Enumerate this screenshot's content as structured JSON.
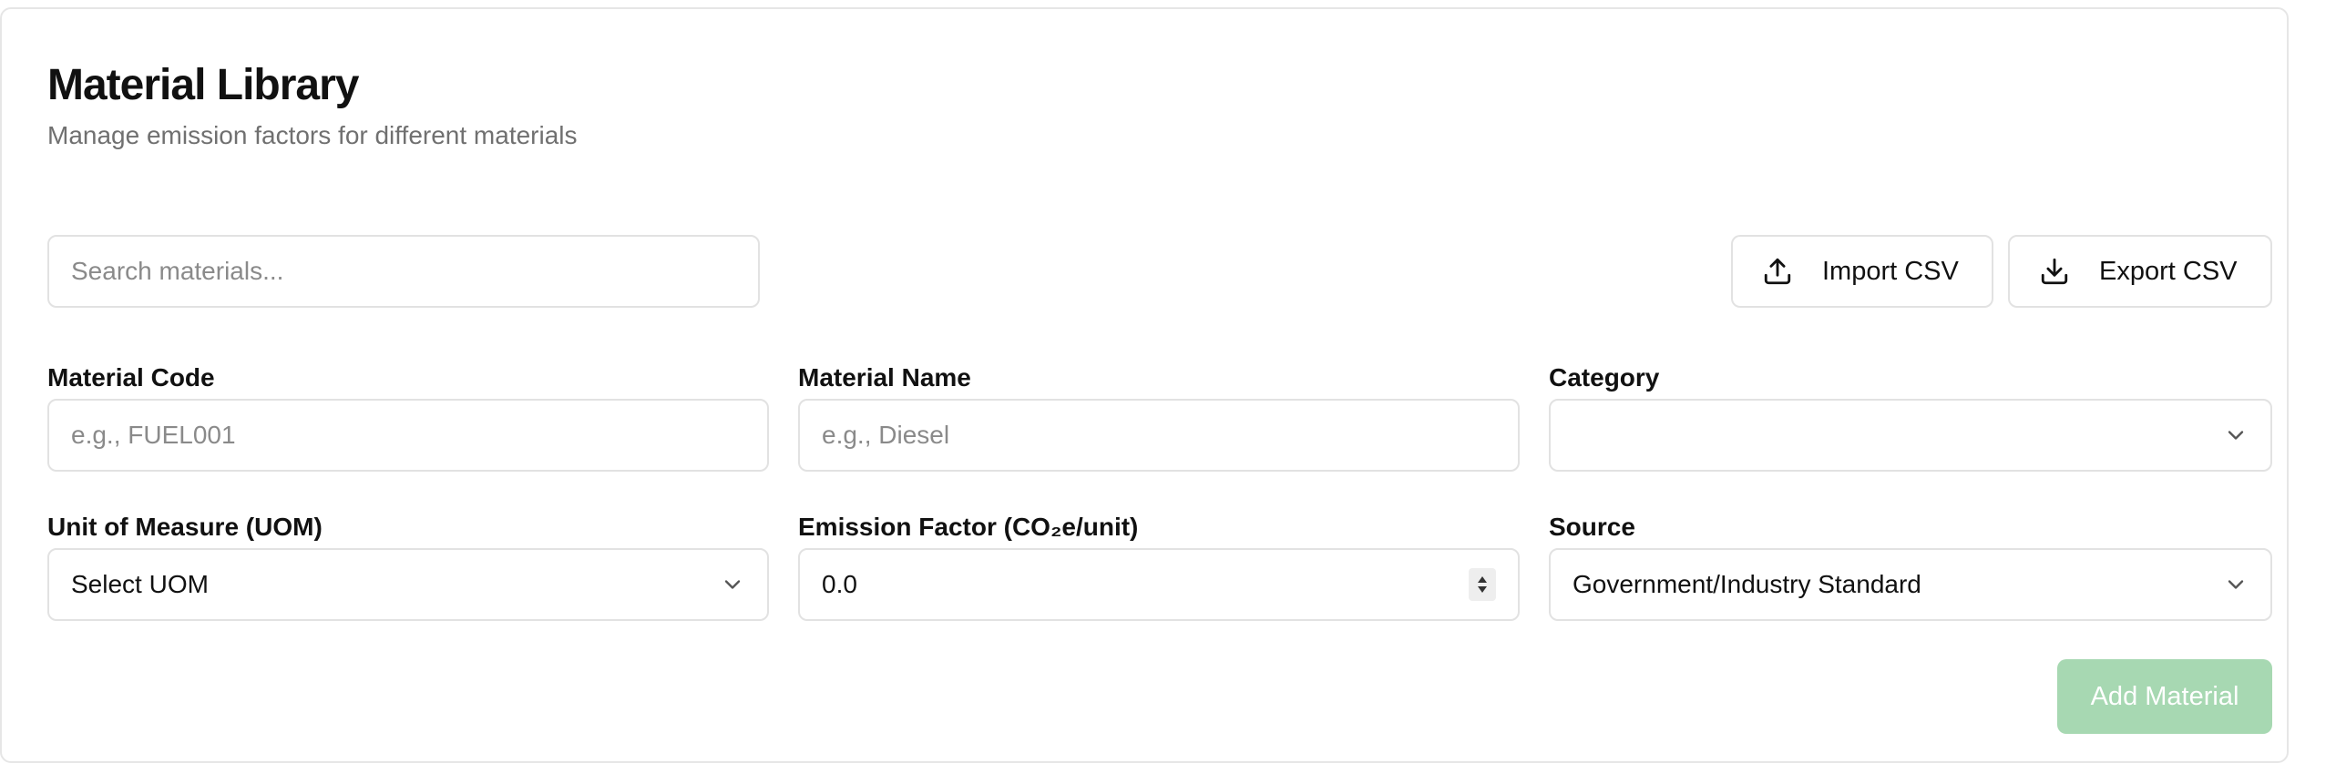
{
  "header": {
    "title": "Material Library",
    "subtitle": "Manage emission factors for different materials"
  },
  "toolbar": {
    "search_placeholder": "Search materials...",
    "import_label": "Import CSV",
    "export_label": "Export CSV"
  },
  "form": {
    "material_code": {
      "label": "Material Code",
      "placeholder": "e.g., FUEL001",
      "value": ""
    },
    "material_name": {
      "label": "Material Name",
      "placeholder": "e.g., Diesel",
      "value": ""
    },
    "category": {
      "label": "Category",
      "value": ""
    },
    "uom": {
      "label": "Unit of Measure (UOM)",
      "value": "Select UOM"
    },
    "emission_factor": {
      "label": "Emission Factor (CO₂e/unit)",
      "value": "0.0"
    },
    "source": {
      "label": "Source",
      "value": "Government/Industry Standard"
    },
    "submit_label": "Add Material"
  },
  "colors": {
    "primary_disabled": "#a7d8b2",
    "border": "#e2e2e2",
    "muted_text": "#707070"
  },
  "icons": {
    "import": "upload-icon",
    "export": "download-icon",
    "dropdown": "chevron-down-icon"
  }
}
